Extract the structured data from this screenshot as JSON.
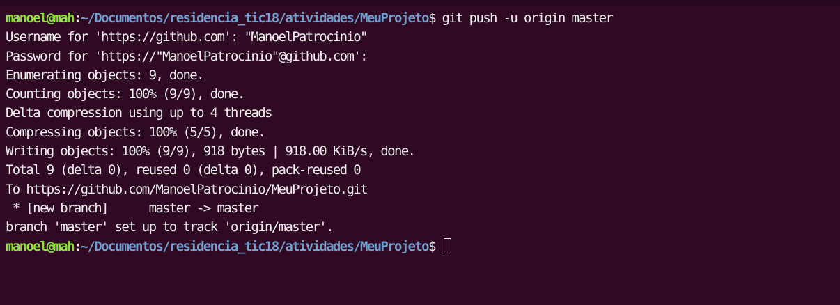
{
  "prompt": {
    "user_host": "manoel@mah",
    "colon": ":",
    "path": "~/Documentos/residencia_tic18/atividades/MeuProjeto",
    "symbol": "$"
  },
  "command": " git push -u origin master",
  "output_lines": [
    "Username for 'https://github.com': \"ManoelPatrocinio\"",
    "Password for 'https://\"ManoelPatrocinio\"@github.com':",
    "Enumerating objects: 9, done.",
    "Counting objects: 100% (9/9), done.",
    "Delta compression using up to 4 threads",
    "Compressing objects: 100% (5/5), done.",
    "Writing objects: 100% (9/9), 918 bytes | 918.00 KiB/s, done.",
    "Total 9 (delta 0), reused 0 (delta 0), pack-reused 0",
    "To https://github.com/ManoelPatrocinio/MeuProjeto.git",
    " * [new branch]      master -> master",
    "branch 'master' set up to track 'origin/master'."
  ],
  "colors": {
    "background": "#300a24",
    "foreground": "#eeeeec",
    "user_host": "#8ae234",
    "path": "#729fcf"
  }
}
